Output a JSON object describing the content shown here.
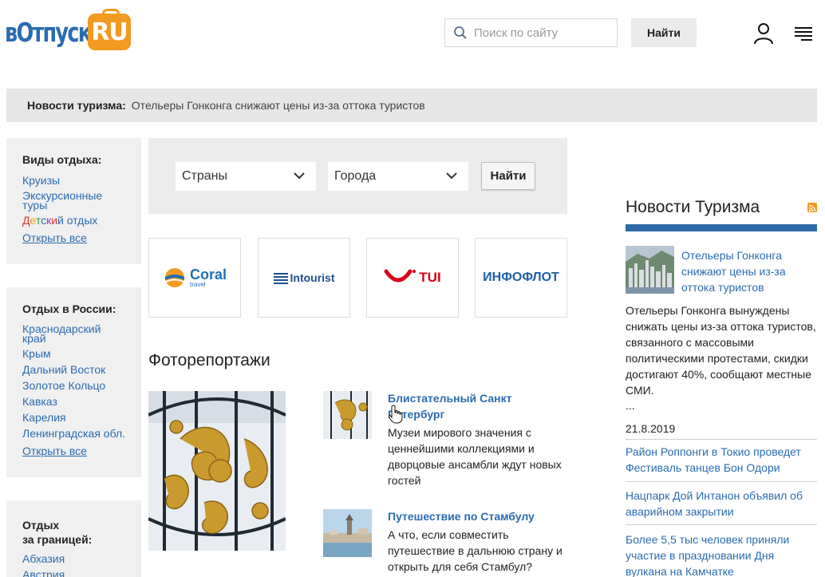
{
  "header": {
    "logo_main": "вОтпуск",
    "logo_badge": "RU",
    "search_placeholder": "Поиск по сайту",
    "search_button": "Найти"
  },
  "newsbar": {
    "label": "Новости туризма:",
    "headline": "Отельеры Гонконга снижают цены из-за оттока туристов"
  },
  "sidebar": {
    "box1": {
      "title": "Виды отдыха:",
      "items": [
        "Круизы",
        "Экскурсионные туры"
      ],
      "kids": [
        "Д",
        "е",
        "т",
        "с",
        "к",
        "и",
        "й",
        " отдых"
      ],
      "all": "Открыть все"
    },
    "box2": {
      "title": "Отдых в России:",
      "items": [
        "Краснодарский край",
        "Крым",
        "Дальний Восток",
        "Золотое Кольцо",
        "Кавказ",
        "Карелия",
        "Ленинградская обл."
      ],
      "all": "Открыть все"
    },
    "box3": {
      "title_line1": "Отдых",
      "title_line2": "за границей:",
      "items": [
        "Абхазия",
        "Австрия"
      ]
    }
  },
  "filter": {
    "countries": "Страны",
    "cities": "Города",
    "button": "Найти"
  },
  "partners": {
    "coral": "Coral",
    "coral_sub": "travel",
    "intourist": "Intourist",
    "tui": "TUI",
    "infoflot": "ИНФОФЛОТ"
  },
  "photo_reports": {
    "title": "Фоторепортажи",
    "articles": [
      {
        "title": "Блистательный Санкт Петербург",
        "text": "Музеи мирового значения с ценнейшими коллекциями и дворцовые ансамбли ждут новых гостей"
      },
      {
        "title": "Путешествие по Стамбулу",
        "text": "А что, если совместить путешествие в дальнюю страну и открыть для себя Стамбул?"
      }
    ]
  },
  "news": {
    "title": "Новости Туризма",
    "lead_link": "Отельеры Гонконга снижают цены из-за оттока туристов",
    "lead_text": "Отельеры Гонконга вынуждены снижать цены из-за оттока туристов, связанного с массовыми политическими протестами, скидки достигают 40%, сообщают местные СМИ.",
    "ellipsis": "...",
    "date": "21.8.2019",
    "links": [
      "Район Роппонги в Токио проведет Фестиваль танцев Бон Одори",
      "Нацпарк Дой Интанон объявил об аварийном закрытии",
      "Более 5,5 тыс человек приняли участие в праздновании Дня вулкана на Камчатке"
    ]
  },
  "colors": {
    "brand_blue": "#2a6cb0",
    "brand_orange": "#f39a21",
    "rule_blue": "#2f6aa8"
  }
}
